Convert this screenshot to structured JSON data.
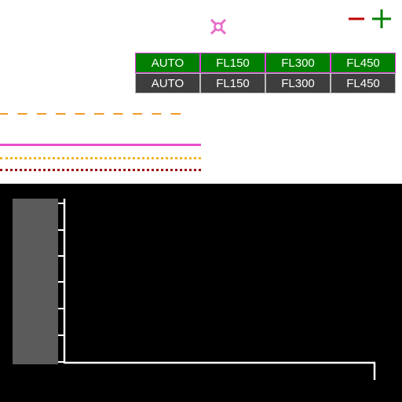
{
  "icons": {
    "waypoint": "waypoint-icon",
    "zoom_out": "minus-icon",
    "zoom_in": "plus-icon"
  },
  "altitude_table": {
    "selected_row": [
      "AUTO",
      "FL150",
      "FL300",
      "FL450"
    ],
    "option_row": [
      "AUTO",
      "FL150",
      "FL300",
      "FL450"
    ]
  },
  "colors": {
    "selected_cell_bg": "#007f00",
    "selected_cell_border": "#e040e0",
    "option_cell_bg": "#3e3e3e",
    "zoom_out": "#c00000",
    "zoom_in": "#007f00",
    "waypoint": "#e86cc8",
    "line_orange": "#f39a2a",
    "line_magenta": "#e84fd0",
    "line_yellow": "#f2b623",
    "line_darkred": "#9b1118",
    "profile_bg": "#000000",
    "profile_strip": "#5b5b5b"
  }
}
